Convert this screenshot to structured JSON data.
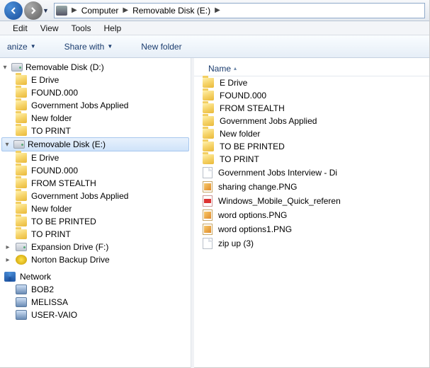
{
  "breadcrumb": {
    "root": "Computer",
    "segment1": "Removable Disk (E:)"
  },
  "menu": {
    "edit": "Edit",
    "view": "View",
    "tools": "Tools",
    "help": "Help"
  },
  "toolbar": {
    "organize": "anize",
    "share": "Share with",
    "newfolder": "New folder"
  },
  "tree": {
    "driveD": {
      "label": "Removable Disk (D:)",
      "items": [
        "E Drive",
        "FOUND.000",
        "Government Jobs Applied",
        "New folder",
        "TO PRINT"
      ]
    },
    "driveE": {
      "label": "Removable Disk (E:)",
      "items": [
        "E Drive",
        "FOUND.000",
        "FROM STEALTH",
        "Government Jobs Applied",
        "New folder",
        "TO BE PRINTED",
        "TO PRINT"
      ]
    },
    "driveF": {
      "label": "Expansion Drive (F:)"
    },
    "norton": {
      "label": "Norton Backup Drive"
    },
    "network": {
      "label": "Network"
    },
    "netItems": [
      "BOB2",
      "MELISSA",
      "USER-VAIO"
    ]
  },
  "list": {
    "header": {
      "name": "Name"
    },
    "rows": [
      {
        "icon": "folder",
        "label": "E Drive"
      },
      {
        "icon": "folder",
        "label": "FOUND.000"
      },
      {
        "icon": "folder",
        "label": "FROM STEALTH"
      },
      {
        "icon": "folder",
        "label": "Government Jobs Applied"
      },
      {
        "icon": "folder",
        "label": "New folder"
      },
      {
        "icon": "folder",
        "label": "TO BE PRINTED"
      },
      {
        "icon": "folder",
        "label": "TO PRINT"
      },
      {
        "icon": "doc",
        "label": "Government Jobs Interview - Di"
      },
      {
        "icon": "png",
        "label": "sharing change.PNG"
      },
      {
        "icon": "pdf",
        "label": "Windows_Mobile_Quick_referen"
      },
      {
        "icon": "png",
        "label": "word options.PNG"
      },
      {
        "icon": "png",
        "label": "word options1.PNG"
      },
      {
        "icon": "doc",
        "label": "zip up (3)"
      }
    ]
  }
}
